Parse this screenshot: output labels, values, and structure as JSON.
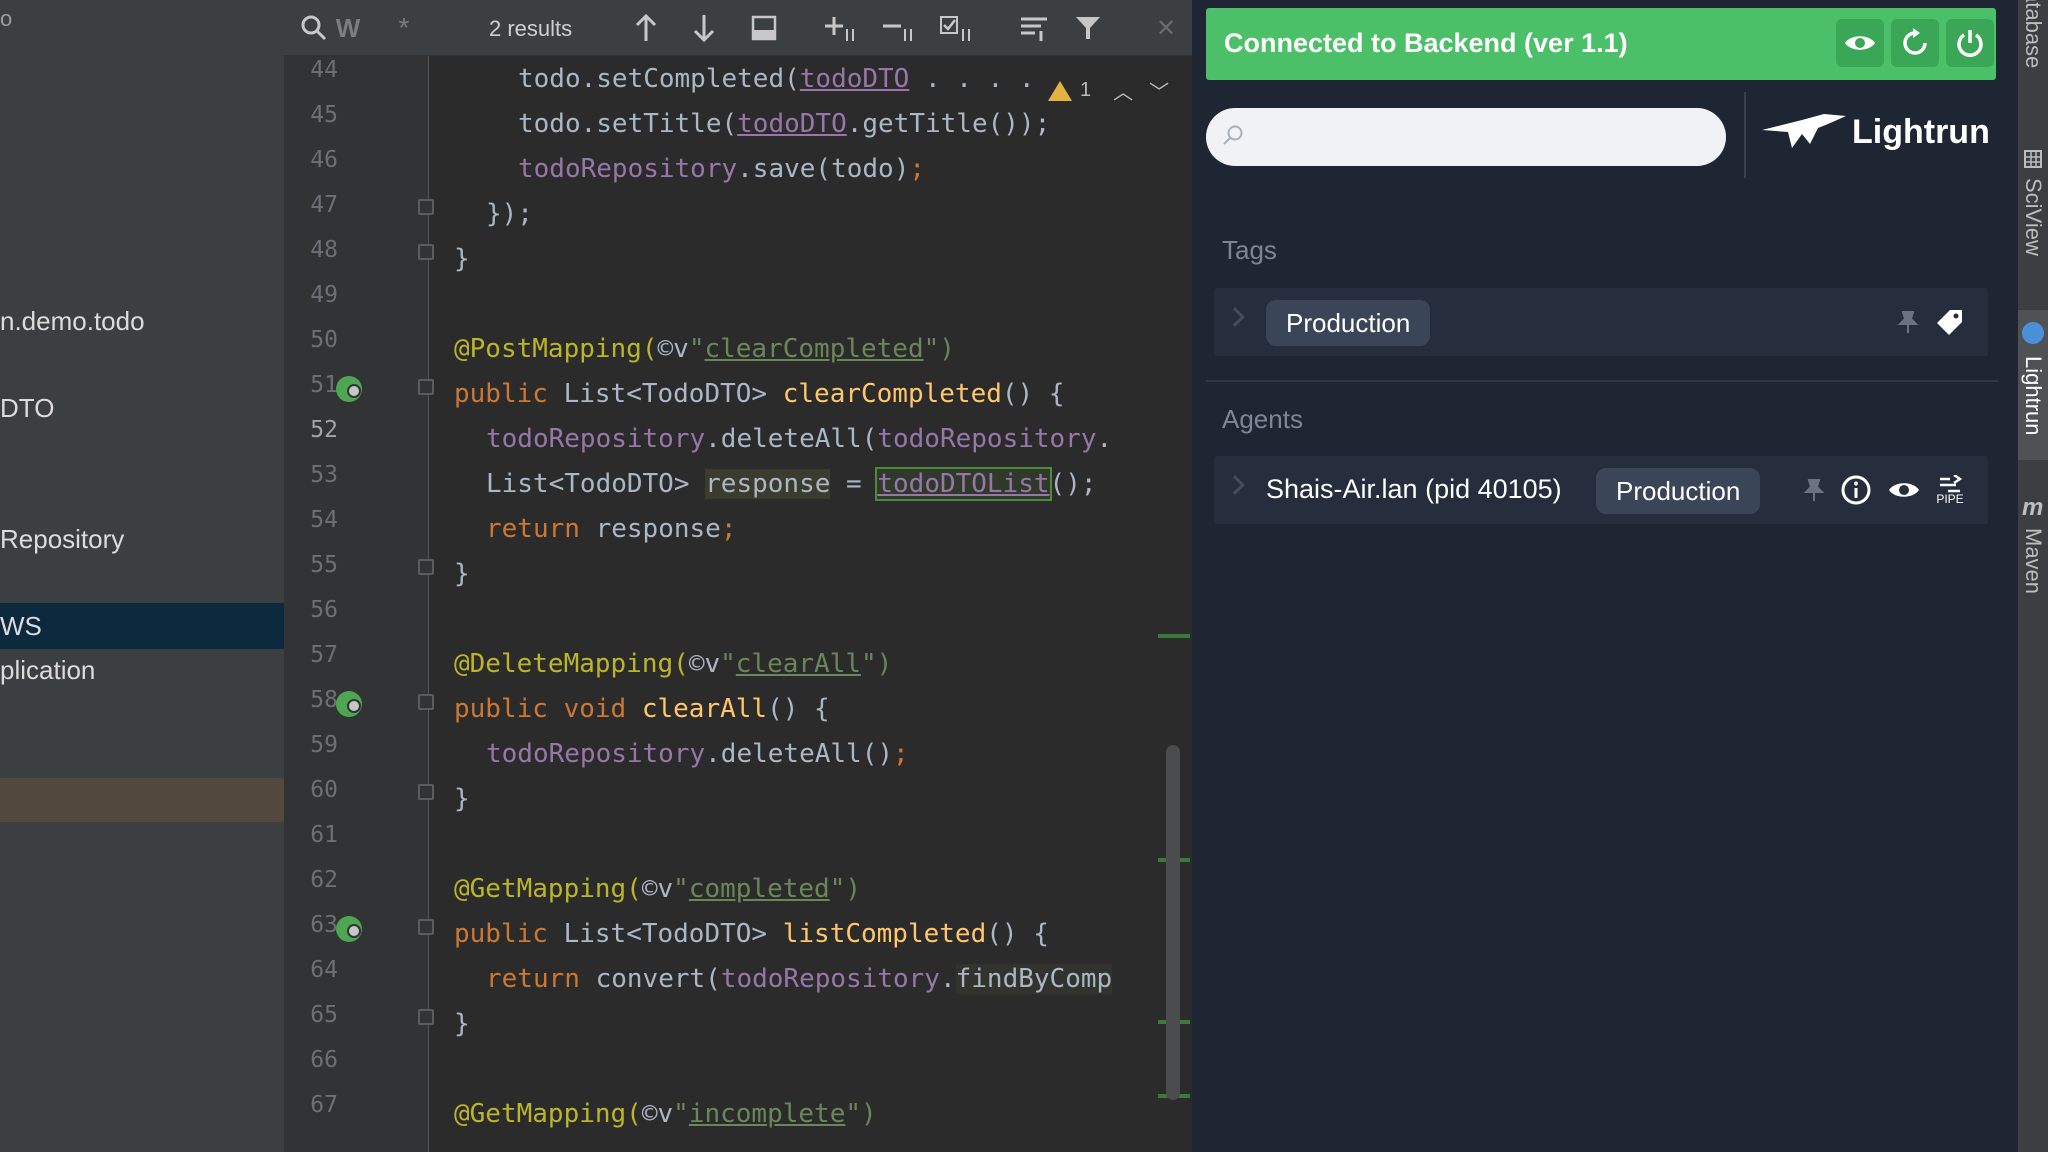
{
  "project_panel": {
    "top_text": "o",
    "items": [
      {
        "label": "n.demo.todo"
      },
      {
        "label": "DTO"
      },
      {
        "label": "Repository"
      },
      {
        "label": "WS"
      },
      {
        "label": "plication"
      }
    ]
  },
  "search_toolbar": {
    "search_glyph": "Q",
    "word_toggle": "W",
    "regex_toggle": "*",
    "results": "2 results"
  },
  "editor": {
    "line_numbers": [
      "44",
      "45",
      "46",
      "47",
      "48",
      "49",
      "50",
      "51",
      "52",
      "53",
      "54",
      "55",
      "56",
      "57",
      "58",
      "59",
      "60",
      "61",
      "62",
      "63",
      "64",
      "65",
      "66",
      "67"
    ],
    "current_line": "52",
    "warning_count": "1"
  },
  "lightrun": {
    "status": "Connected to Backend (ver 1.1)",
    "logo": "Lightrun",
    "search_placeholder": "",
    "tags_title": "Tags",
    "tag_pill": "Production",
    "agents_title": "Agents",
    "agent_name": "Shais-Air.lan (pid 40105)",
    "agent_tag": "Production",
    "pipe_label": "PIPE",
    "colors": {
      "status_green": "#4cc068",
      "panel_bg": "#1e2533"
    }
  },
  "tool_strip": {
    "tabs": [
      "atabase",
      "SciView",
      "Lightrun",
      "Maven"
    ]
  }
}
